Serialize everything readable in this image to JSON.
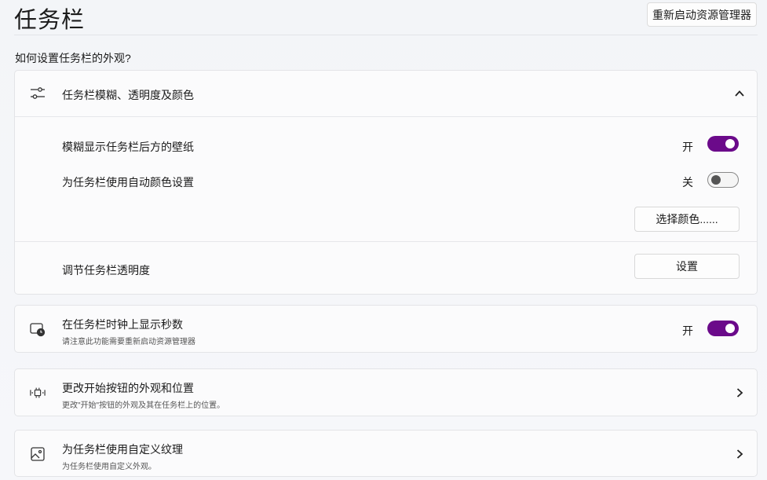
{
  "header": {
    "title": "任务栏",
    "restart_button": "重新启动资源管理器"
  },
  "section": {
    "label": "如何设置任务栏的外观?"
  },
  "appearance_card": {
    "title": "任务栏模糊、透明度及颜色",
    "icon": "sliders-icon",
    "expanded": true,
    "blur_row": {
      "label": "模糊显示任务栏后方的壁纸",
      "state_text": "开",
      "on": true
    },
    "auto_color_row": {
      "label": "为任务栏使用自动颜色设置",
      "state_text": "关",
      "on": false
    },
    "choose_color_button": "选择颜色......",
    "transparency_row": {
      "label": "调节任务栏透明度",
      "button": "设置"
    }
  },
  "clock_card": {
    "title": "在任务栏时钟上显示秒数",
    "subtitle": "请注意此功能需要重新启动资源管理器",
    "icon": "clock-display-icon",
    "state_text": "开",
    "on": true
  },
  "start_button_card": {
    "title": "更改开始按钮的外观和位置",
    "subtitle": "更改\"开始\"按钮的外观及其在任务栏上的位置。",
    "icon": "start-button-icon"
  },
  "texture_card": {
    "title": "为任务栏使用自定义纹理",
    "subtitle": "为任务栏使用自定义外观。",
    "icon": "image-icon"
  },
  "colors": {
    "accent": "#6b0a8a"
  }
}
